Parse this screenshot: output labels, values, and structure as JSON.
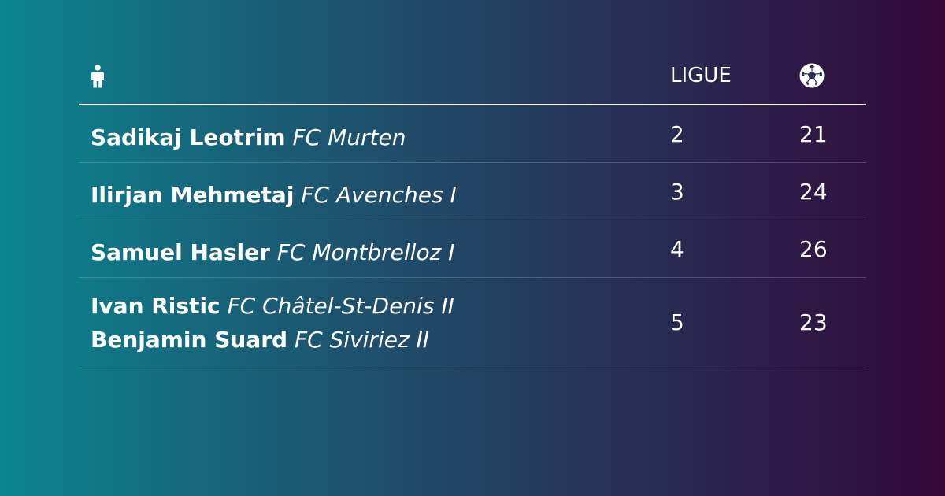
{
  "header": {
    "player_icon": "person-icon",
    "ligue_label": "LIGUE",
    "goals_icon": "soccer-ball-icon"
  },
  "rows": [
    {
      "players": [
        {
          "name": "Sadikaj Leotrim",
          "club": "FC Murten"
        }
      ],
      "ligue": "2",
      "goals": "21"
    },
    {
      "players": [
        {
          "name": "Ilirjan Mehmetaj",
          "club": "FC Avenches I"
        }
      ],
      "ligue": "3",
      "goals": "24"
    },
    {
      "players": [
        {
          "name": "Samuel Hasler",
          "club": "FC Montbrelloz I"
        }
      ],
      "ligue": "4",
      "goals": "26"
    },
    {
      "players": [
        {
          "name": "Ivan Ristic",
          "club": "FC Châtel-St-Denis II"
        },
        {
          "name": "Benjamin Suard",
          "club": "FC Siviriez II"
        }
      ],
      "ligue": "5",
      "goals": "23"
    }
  ],
  "colors": {
    "gradient_start": "#0b8590",
    "gradient_end": "#330838",
    "text": "#ffffff"
  }
}
